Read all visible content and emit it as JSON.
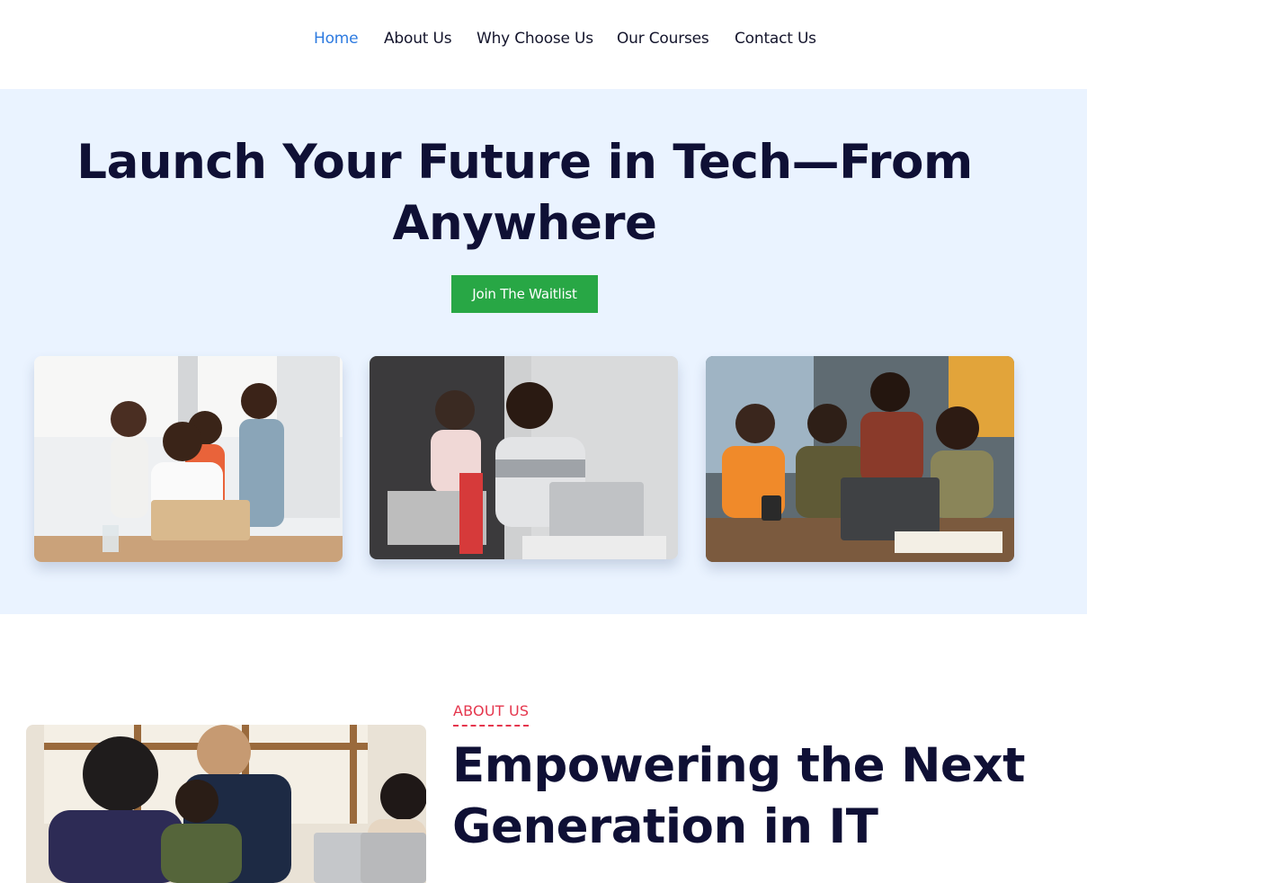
{
  "nav": {
    "items": [
      {
        "label": "Home",
        "active": true
      },
      {
        "label": "About Us",
        "active": false
      },
      {
        "label": "Why Choose Us",
        "active": false
      },
      {
        "label": "Our Courses",
        "active": false
      },
      {
        "label": "Contact Us",
        "active": false
      }
    ]
  },
  "hero": {
    "title": "Launch Your Future in Tech—From Anywhere",
    "cta_label": "Join The Waitlist",
    "images": [
      {
        "name": "students-group-laptop-photo"
      },
      {
        "name": "student-smiling-laptop-photo"
      },
      {
        "name": "friends-studying-together-photo"
      }
    ]
  },
  "about": {
    "eyebrow": "ABOUT US",
    "title": "Empowering the Next Generation in IT"
  },
  "colors": {
    "accent": "#2e7be0",
    "hero_bg": "#eaf3ff",
    "cta": "#28a745",
    "eyebrow": "#e5364d",
    "heading": "#0f1035"
  }
}
